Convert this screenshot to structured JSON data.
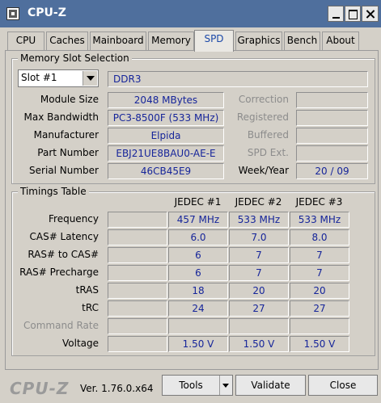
{
  "window": {
    "title": "CPU-Z"
  },
  "tabs": [
    {
      "label": "CPU"
    },
    {
      "label": "Caches"
    },
    {
      "label": "Mainboard"
    },
    {
      "label": "Memory"
    },
    {
      "label": "SPD"
    },
    {
      "label": "Graphics"
    },
    {
      "label": "Bench"
    },
    {
      "label": "About"
    }
  ],
  "memory_slot_selection": {
    "title": "Memory Slot Selection",
    "slot_selected": "Slot #1",
    "type": "DDR3",
    "module_size": {
      "label": "Module Size",
      "value": "2048 MBytes"
    },
    "max_bandwidth": {
      "label": "Max Bandwidth",
      "value": "PC3-8500F (533 MHz)"
    },
    "manufacturer": {
      "label": "Manufacturer",
      "value": "Elpida"
    },
    "part_number": {
      "label": "Part Number",
      "value": "EBJ21UE8BAU0-AE-E"
    },
    "serial_number": {
      "label": "Serial Number",
      "value": "46CB45E9"
    },
    "correction": {
      "label": "Correction",
      "value": ""
    },
    "registered": {
      "label": "Registered",
      "value": ""
    },
    "buffered": {
      "label": "Buffered",
      "value": ""
    },
    "spd_ext": {
      "label": "SPD Ext.",
      "value": ""
    },
    "week_year": {
      "label": "Week/Year",
      "value": "20 / 09"
    }
  },
  "timings_table": {
    "title": "Timings Table",
    "columns": [
      "JEDEC #1",
      "JEDEC #2",
      "JEDEC #3"
    ],
    "rows": [
      {
        "label": "Frequency",
        "values": [
          "457 MHz",
          "533 MHz",
          "533 MHz"
        ]
      },
      {
        "label": "CAS# Latency",
        "values": [
          "6.0",
          "7.0",
          "8.0"
        ]
      },
      {
        "label": "RAS# to CAS#",
        "values": [
          "6",
          "7",
          "7"
        ]
      },
      {
        "label": "RAS# Precharge",
        "values": [
          "6",
          "7",
          "7"
        ]
      },
      {
        "label": "tRAS",
        "values": [
          "18",
          "20",
          "20"
        ]
      },
      {
        "label": "tRC",
        "values": [
          "24",
          "27",
          "27"
        ]
      },
      {
        "label": "Command Rate",
        "values": [
          "",
          "",
          ""
        ]
      },
      {
        "label": "Voltage",
        "values": [
          "1.50 V",
          "1.50 V",
          "1.50 V"
        ]
      }
    ]
  },
  "footer": {
    "logo": "CPU-Z",
    "version": "Ver. 1.76.0.x64",
    "tools_label": "Tools",
    "validate_label": "Validate",
    "close_label": "Close"
  }
}
